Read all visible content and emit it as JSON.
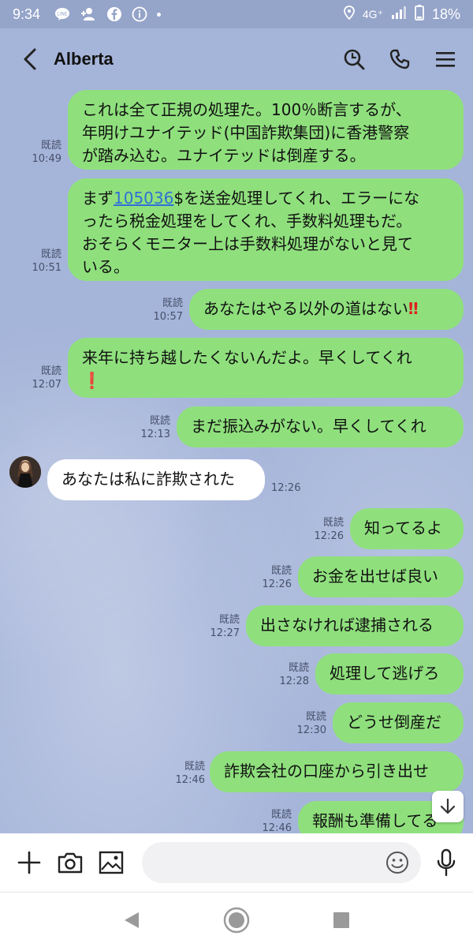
{
  "status_bar": {
    "time": "9:34",
    "network": "4G⁺",
    "battery": "18%"
  },
  "header": {
    "title": "Alberta"
  },
  "messages": [
    {
      "dir": "out",
      "lines": [
        "これは全て正規の処理た。100％断言するが、",
        "年明けユナイテッド(中国詐欺集団)に香港警察",
        "が踏み込む。ユナイテッドは倒産する。"
      ],
      "read": "既読",
      "time": "10:49"
    },
    {
      "dir": "out",
      "line1_pre": "まず",
      "line1_link": "105036",
      "line1_post": "$を送金処理してくれ、エラーにな",
      "lines_rest": [
        "ったら税金処理をしてくれ、手数料処理もだ。",
        "おそらくモニター上は手数料処理がないと見て",
        "いる。"
      ],
      "read": "既読",
      "time": "10:51"
    },
    {
      "dir": "out",
      "text": "あなたはやる以外の道はない",
      "emoji": "‼",
      "read": "既読",
      "time": "10:57"
    },
    {
      "dir": "out",
      "text": "来年に持ち越したくないんだよ。早くしてくれ",
      "emoji": "❗",
      "read": "既読",
      "time": "12:07"
    },
    {
      "dir": "out",
      "text": "まだ振込みがない。早くしてくれ",
      "read": "既読",
      "time": "12:13"
    },
    {
      "dir": "in",
      "text": "あなたは私に詐欺された",
      "time": "12:26"
    },
    {
      "dir": "out",
      "text": "知ってるよ",
      "read": "既読",
      "time": "12:26"
    },
    {
      "dir": "out",
      "text": "お金を出せば良い",
      "read": "既読",
      "time": "12:26"
    },
    {
      "dir": "out",
      "text": "出さなければ逮捕される",
      "read": "既読",
      "time": "12:27"
    },
    {
      "dir": "out",
      "text": "処理して逃げろ",
      "read": "既読",
      "time": "12:28"
    },
    {
      "dir": "out",
      "text": "どうせ倒産だ",
      "read": "既読",
      "time": "12:30"
    },
    {
      "dir": "out",
      "text": "詐欺会社の口座から引き出せ",
      "read": "既読",
      "time": "12:46"
    },
    {
      "dir": "out",
      "text": "報酬も準備してる",
      "read": "既読",
      "time": "12:46"
    }
  ],
  "input": {
    "placeholder": ""
  },
  "icons": {
    "back": "back-arrow-icon",
    "search": "search-icon",
    "call": "phone-icon",
    "menu": "menu-icon",
    "add": "plus-icon",
    "camera": "camera-icon",
    "image": "image-icon",
    "emoji": "emoji-icon",
    "mic": "microphone-icon",
    "scroll_down": "arrow-down-icon"
  },
  "colors": {
    "background": "#a5b4d9",
    "outgoing_bubble": "#8fe07d",
    "incoming_bubble": "#ffffff",
    "link": "#2f6fd6",
    "alert": "#e02020"
  }
}
